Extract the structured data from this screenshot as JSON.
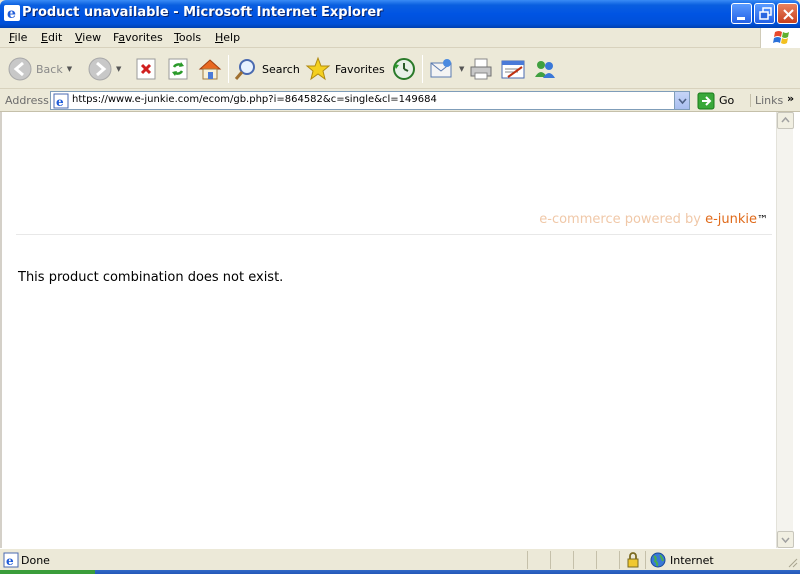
{
  "window": {
    "title": "Product unavailable - Microsoft Internet Explorer",
    "icon": "ie-icon",
    "controls": [
      "minimize",
      "maximize",
      "close"
    ]
  },
  "menubar": {
    "items": [
      {
        "label": "File",
        "key": "F"
      },
      {
        "label": "Edit",
        "key": "E"
      },
      {
        "label": "View",
        "key": "V"
      },
      {
        "label": "Favorites",
        "key": "a"
      },
      {
        "label": "Tools",
        "key": "T"
      },
      {
        "label": "Help",
        "key": "H"
      }
    ]
  },
  "toolbar": {
    "back_label": "Back",
    "search_label": "Search",
    "favorites_label": "Favorites"
  },
  "address": {
    "label": "Address",
    "url": "https://www.e-junkie.com/ecom/gb.php?i=864582&c=single&cl=149684",
    "go_label": "Go",
    "links_label": "Links",
    "chevron": "»"
  },
  "page": {
    "powered_prefix": "e-commerce powered by ",
    "powered_brand": "e-junkie",
    "powered_tm": "™",
    "message": "This product combination does not exist."
  },
  "statusbar": {
    "status": "Done",
    "zone": "Internet"
  },
  "colors": {
    "titlebar": "#0054e3",
    "brand": "#e06a1a",
    "brand_light": "#f0c8a8"
  }
}
